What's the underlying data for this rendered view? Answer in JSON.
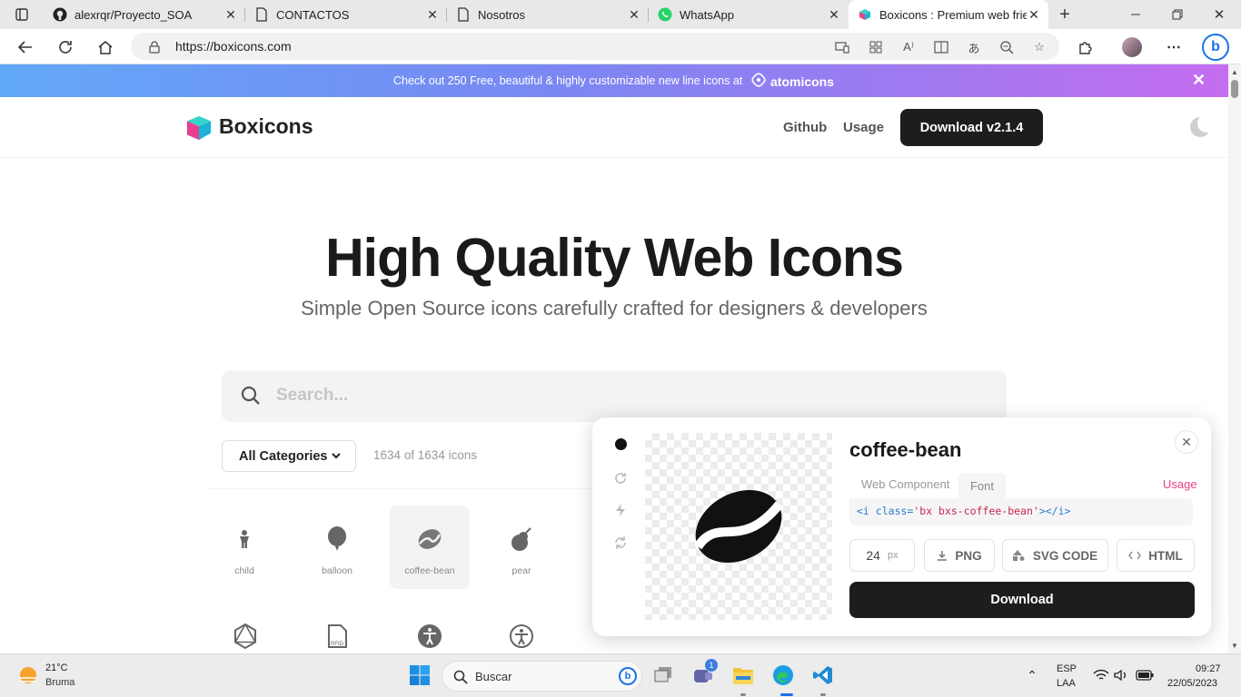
{
  "browser": {
    "tabs": [
      {
        "label": "alexrqr/Proyecto_SOA",
        "icon": "github-icon"
      },
      {
        "label": "CONTACTOS",
        "icon": "page-icon"
      },
      {
        "label": "Nosotros",
        "icon": "page-icon"
      },
      {
        "label": "WhatsApp",
        "icon": "whatsapp-icon"
      },
      {
        "label": "Boxicons : Premium web frien",
        "icon": "boxicons-icon",
        "active": true
      }
    ],
    "url": "https://boxicons.com"
  },
  "banner": {
    "text": "Check out 250 Free, beautiful & highly customizable new line icons at",
    "brand": "atomicons",
    "close": "✕"
  },
  "header": {
    "logo": "Boxicons",
    "nav": [
      "Github",
      "Usage"
    ],
    "download": "Download v2.1.4"
  },
  "hero": {
    "title": "High Quality Web Icons",
    "subtitle": "Simple Open Source icons carefully crafted for designers & developers"
  },
  "search": {
    "placeholder": "Search..."
  },
  "filters": {
    "category": "All Categories",
    "count": "1634 of 1634 icons"
  },
  "icons": [
    {
      "label": "child",
      "icon": "child-icon"
    },
    {
      "label": "balloon",
      "icon": "balloon-icon"
    },
    {
      "label": "coffee-bean",
      "icon": "coffee-bean-icon",
      "selected": true
    },
    {
      "label": "pear",
      "icon": "pear-icon"
    }
  ],
  "panel": {
    "name": "coffee-bean",
    "tabs": [
      "Web Component",
      "Font"
    ],
    "active_tab": "Font",
    "usage": "Usage",
    "code": {
      "open_tag": "<i",
      "attr": "class=",
      "value": "'bx bxs-coffee-bean'",
      "close": "></",
      "end_tag": "i>"
    },
    "size": "24",
    "size_unit": "px",
    "buttons": [
      "PNG",
      "SVG CODE",
      "HTML"
    ],
    "download": "Download"
  },
  "taskbar": {
    "temp": "21°C",
    "weather": "Bruma",
    "search": "Buscar",
    "lang": "ESP",
    "layout": "LAA",
    "time": "09:27",
    "date": "22/05/2023",
    "teams_badge": "1"
  },
  "colors": {
    "accent_pink": "#e83e8c",
    "dark": "#1d1d1f"
  }
}
